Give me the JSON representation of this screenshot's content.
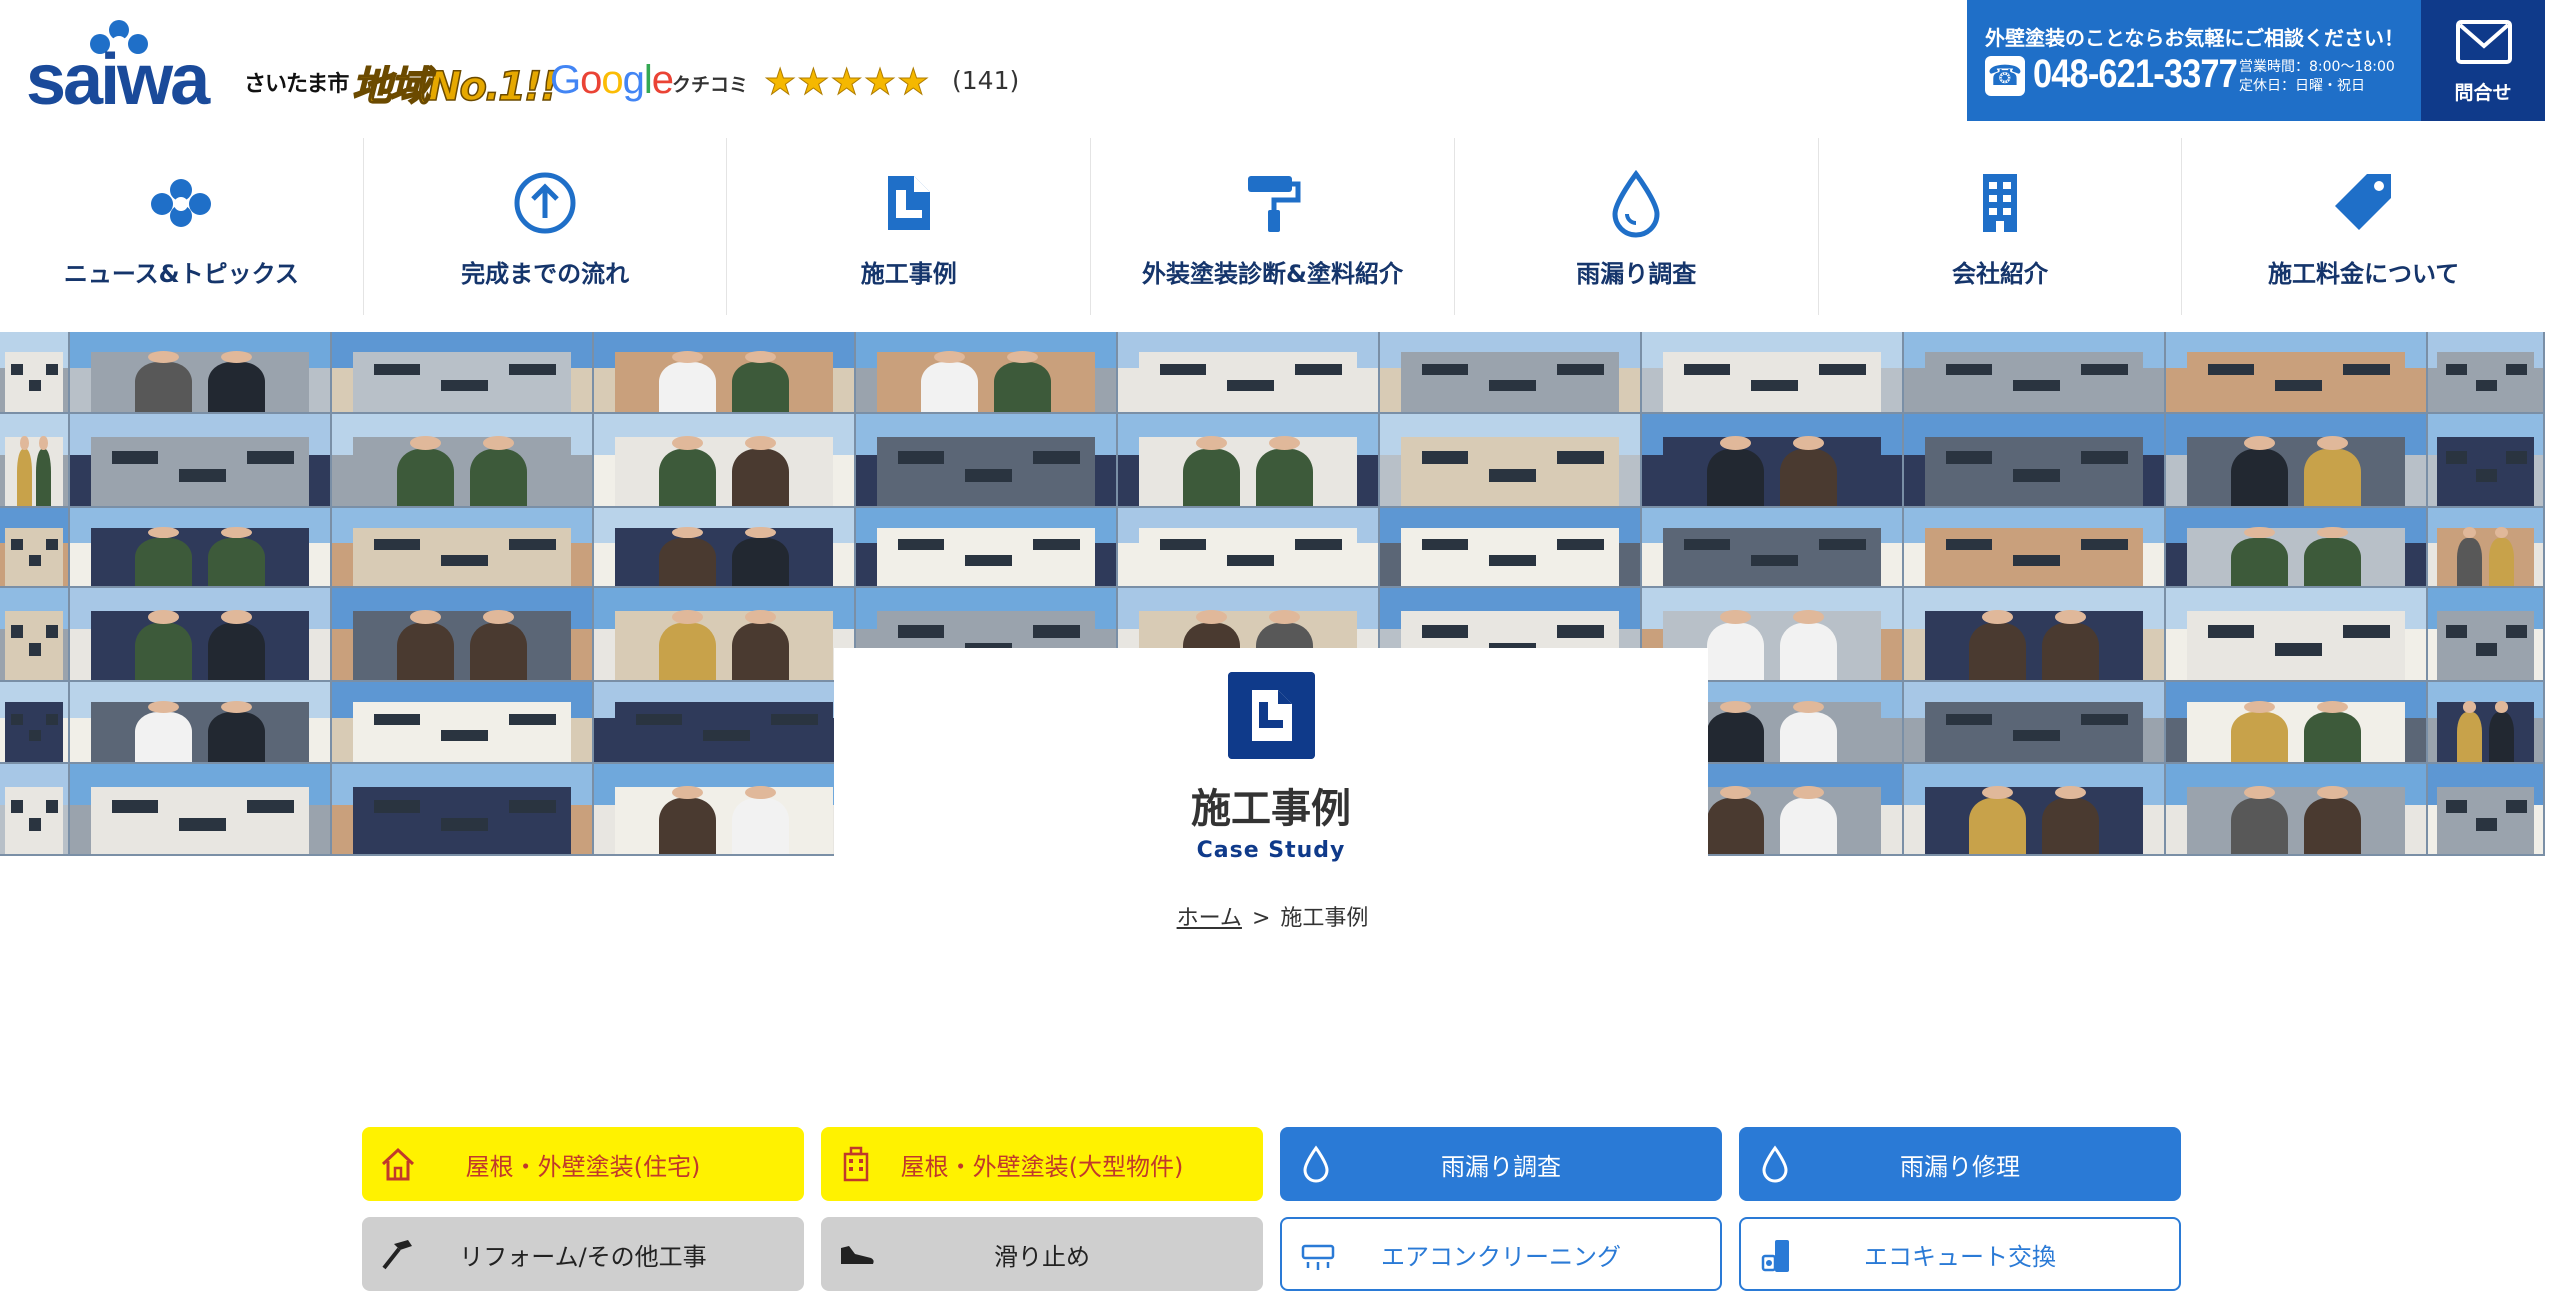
{
  "header": {
    "logo_text": "saiwa",
    "city_badge": "さいたま市",
    "no1_badge": "地域No.1!!",
    "google_letters": [
      "G",
      "o",
      "o",
      "g",
      "l",
      "e"
    ],
    "kuchikomi": "クチコミ",
    "stars": "★★★★★",
    "review_count": "(141)",
    "contact": {
      "lead": "外壁塗装のことならお気軽にご相談ください！",
      "phone": "048-621-3377",
      "hours_line1": "営業時間：8:00〜18:00",
      "hours_line2": "定休日：日曜・祝日",
      "mail_label": "問合せ"
    }
  },
  "nav": {
    "items": [
      {
        "label": "ニュース&トピックス",
        "icon": "cloud-network-icon"
      },
      {
        "label": "完成までの流れ",
        "icon": "arrow-up-circle-icon"
      },
      {
        "label": "施工事例",
        "icon": "document-icon"
      },
      {
        "label": "外装塗装診断&塗料紹介",
        "icon": "paint-roller-icon"
      },
      {
        "label": "雨漏り調査",
        "icon": "water-drop-icon"
      },
      {
        "label": "会社紹介",
        "icon": "building-icon"
      },
      {
        "label": "施工料金について",
        "icon": "price-tag-icon"
      }
    ]
  },
  "hero": {
    "title": "施工事例",
    "subtitle": "Case Study",
    "icon": "document-icon"
  },
  "breadcrumb": {
    "home": "ホーム",
    "separator": ">",
    "current": "施工事例"
  },
  "categories": {
    "row1": [
      {
        "label": "屋根・外壁塗装(住宅)",
        "icon": "house-icon",
        "style": "yellow"
      },
      {
        "label": "屋根・外壁塗装(大型物件)",
        "icon": "apartment-icon",
        "style": "yellow"
      },
      {
        "label": "雨漏り調査",
        "icon": "water-drop-icon",
        "style": "blue"
      },
      {
        "label": "雨漏り修理",
        "icon": "water-drop-icon",
        "style": "blue"
      }
    ],
    "row2": [
      {
        "label": "リフォーム/その他工事",
        "icon": "hammer-icon",
        "style": "gray"
      },
      {
        "label": "滑り止め",
        "icon": "shoe-icon",
        "style": "gray"
      },
      {
        "label": "エアコンクリーニング",
        "icon": "air-conditioner-icon",
        "style": "outline"
      },
      {
        "label": "エコキュート交換",
        "icon": "water-heater-icon",
        "style": "outline"
      }
    ]
  },
  "colors": {
    "brand_navy": "#0f3a8a",
    "brand_blue": "#1f6fc8",
    "button_blue": "#2a7ad6",
    "button_yellow": "#fff200",
    "button_gray": "#cfcfcf"
  }
}
